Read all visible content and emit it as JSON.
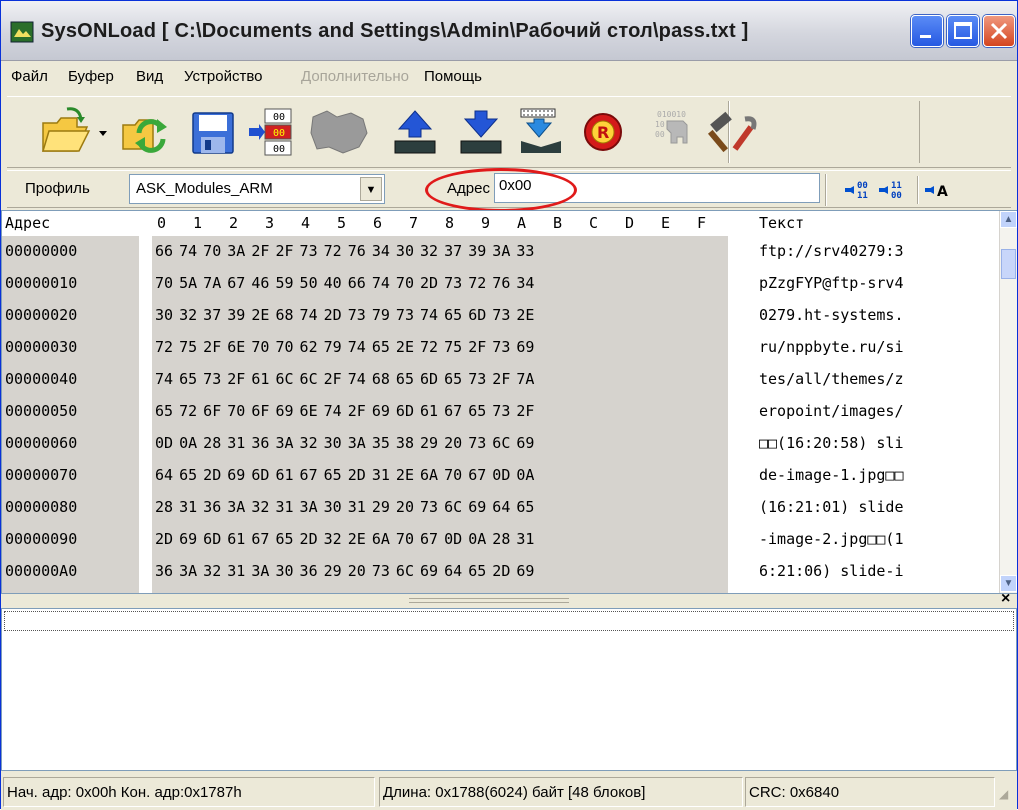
{
  "window": {
    "title": "SysONLoad   [ C:\\Documents and Settings\\Admin\\Рабочий стол\\pass.txt ]",
    "icon": "app-icon",
    "buttons": [
      "minimize-icon",
      "maximize-icon",
      "close-icon"
    ]
  },
  "menu": [
    {
      "label": "Файл",
      "enabled": true
    },
    {
      "label": "Буфер",
      "enabled": true
    },
    {
      "label": "Вид",
      "enabled": true
    },
    {
      "label": "Устройство",
      "enabled": true
    },
    {
      "label": "Дополнительно",
      "enabled": false
    },
    {
      "label": "Помощь",
      "enabled": true
    }
  ],
  "toolbar": {
    "buttons": [
      {
        "icon": "open-folder-icon",
        "enabled": true
      },
      {
        "icon": "dropdown-arrow-icon",
        "enabled": true
      },
      {
        "icon": "reload-icon",
        "enabled": true
      },
      {
        "icon": "save-disk-icon",
        "enabled": true
      },
      {
        "icon": "insert-bytes-icon",
        "enabled": true
      },
      {
        "icon": "map-icon",
        "enabled": false
      },
      {
        "icon": "upload-to-device-icon",
        "enabled": true
      },
      {
        "icon": "download-from-device-icon",
        "enabled": true
      },
      {
        "icon": "write-chip-icon",
        "enabled": true
      },
      {
        "icon": "reset-r-icon",
        "enabled": true
      },
      {
        "icon": "key-icon",
        "enabled": false
      },
      {
        "icon": "tools-icon",
        "enabled": true
      }
    ]
  },
  "addressbar": {
    "profile_label": "Профиль",
    "profile_value": "ASK_Modules_ARM",
    "address_label": "Адрес",
    "address_value": "0x00",
    "highlight_color": "#e01a1a",
    "buttons": [
      {
        "icon": "goto-next-icon",
        "text": "00\n11"
      },
      {
        "icon": "goto-prev-icon",
        "text": "11\n00"
      },
      {
        "icon": "goto-text-icon",
        "text": "A"
      }
    ]
  },
  "hexview": {
    "header_address": "Адрес",
    "header_columns": [
      "0",
      "1",
      "2",
      "3",
      "4",
      "5",
      "6",
      "7",
      "8",
      "9",
      "A",
      "B",
      "C",
      "D",
      "E",
      "F"
    ],
    "header_text": "Текст",
    "rows": [
      {
        "address": "00000000",
        "hex": "66 74 70 3A 2F 2F 73 72 76 34 30 32 37 39 3A 33",
        "text": "ftp://srv40279:3"
      },
      {
        "address": "00000010",
        "hex": "70 5A 7A 67 46 59 50 40 66 74 70 2D 73 72 76 34",
        "text": "pZzgFYP@ftp-srv4"
      },
      {
        "address": "00000020",
        "hex": "30 32 37 39 2E 68 74 2D 73 79 73 74 65 6D 73 2E",
        "text": "0279.ht-systems."
      },
      {
        "address": "00000030",
        "hex": "72 75 2F 6E 70 70 62 79 74 65 2E 72 75 2F 73 69",
        "text": "ru/nppbyte.ru/si"
      },
      {
        "address": "00000040",
        "hex": "74 65 73 2F 61 6C 6C 2F 74 68 65 6D 65 73 2F 7A",
        "text": "tes/all/themes/z"
      },
      {
        "address": "00000050",
        "hex": "65 72 6F 70 6F 69 6E 74 2F 69 6D 61 67 65 73 2F",
        "text": "eropoint/images/"
      },
      {
        "address": "00000060",
        "hex": "0D 0A 28 31 36 3A 32 30 3A 35 38 29 20 73 6C 69",
        "text": "□□(16:20:58) sli"
      },
      {
        "address": "00000070",
        "hex": "64 65 2D 69 6D 61 67 65 2D 31 2E 6A 70 67 0D 0A",
        "text": "de-image-1.jpg□□"
      },
      {
        "address": "00000080",
        "hex": "28 31 36 3A 32 31 3A 30 31 29 20 73 6C 69 64 65",
        "text": "(16:21:01) slide"
      },
      {
        "address": "00000090",
        "hex": "2D 69 6D 61 67 65 2D 32 2E 6A 70 67 0D 0A 28 31",
        "text": "-image-2.jpg□□(1"
      },
      {
        "address": "000000A0",
        "hex": "36 3A 32 31 3A 30 36 29 20 73 6C 69 64 65 2D 69",
        "text": "6:21:06) slide-i"
      }
    ]
  },
  "statusbar": {
    "range": "Нач. адр: 0x00h  Кон. адр:0x1787h",
    "length": "Длина: 0x1788(6024) байт [48 блоков]",
    "crc": "CRC: 0x6840"
  }
}
